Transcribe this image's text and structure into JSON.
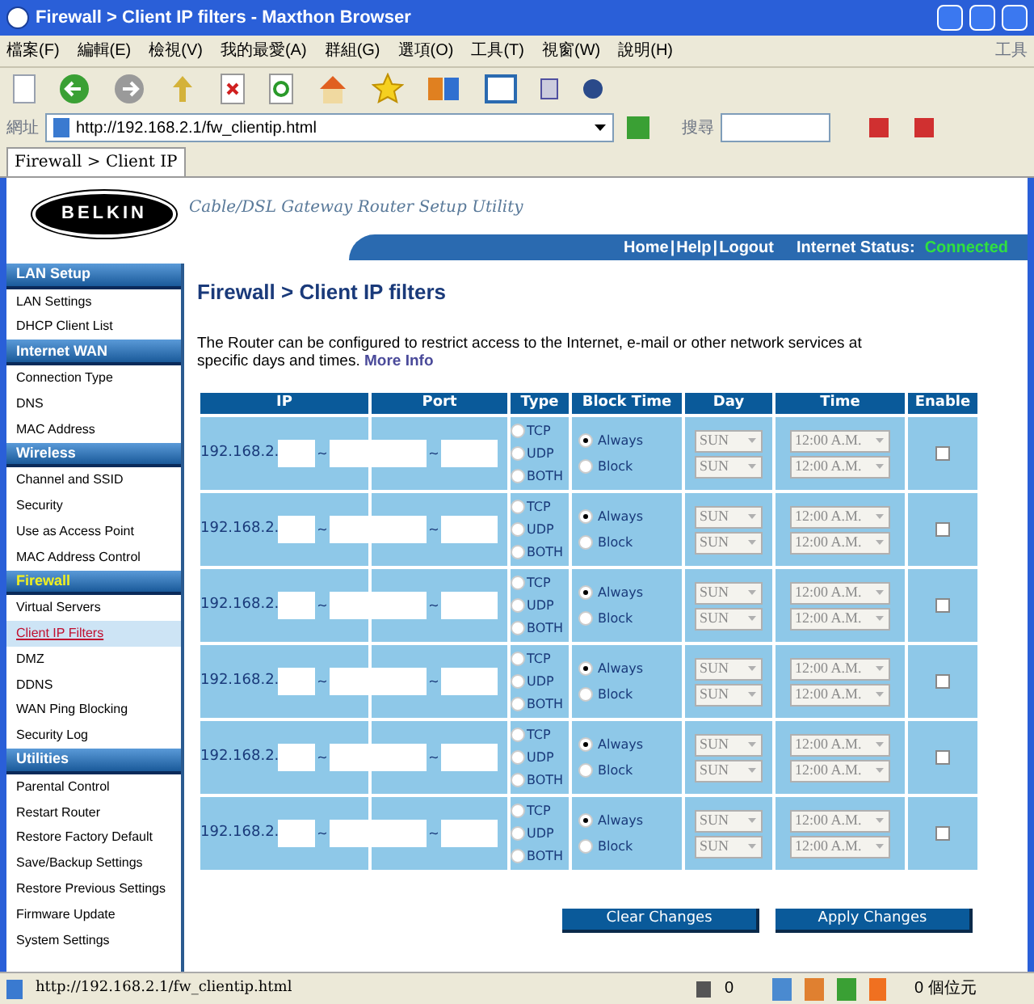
{
  "window": {
    "title": "Firewall > Client IP filters - Maxthon Browser"
  },
  "menu": [
    "檔案(F)",
    "編輯(E)",
    "檢視(V)",
    "我的最愛(A)",
    "群組(G)",
    "選項(O)",
    "工具(T)",
    "視窗(W)",
    "說明(H)"
  ],
  "menu_right": "工具",
  "address_bar": {
    "label": "網址",
    "value": "http://192.168.2.1/fw_clientip.html",
    "search_label": "搜尋"
  },
  "tabs": [
    {
      "label": "Firewall > Client IP",
      "selected": true
    }
  ],
  "header": {
    "logo": "BELKIN",
    "subtitle": "Cable/DSL Gateway Router Setup Utility",
    "links": [
      "Home",
      "Help",
      "Logout"
    ],
    "link_separator": "|",
    "status_label": "Internet Status:",
    "status_value": "Connected"
  },
  "sidebar": [
    {
      "kind": "section",
      "label": "LAN Setup",
      "selected": false
    },
    {
      "kind": "item",
      "label": "LAN Settings",
      "selected": false
    },
    {
      "kind": "item",
      "label": "DHCP Client List",
      "selected": false
    },
    {
      "kind": "section",
      "label": "Internet WAN",
      "selected": false
    },
    {
      "kind": "item",
      "label": "Connection Type",
      "selected": false
    },
    {
      "kind": "item",
      "label": "DNS",
      "selected": false
    },
    {
      "kind": "item",
      "label": "MAC Address",
      "selected": false
    },
    {
      "kind": "section",
      "label": "Wireless",
      "selected": false
    },
    {
      "kind": "item",
      "label": "Channel and SSID",
      "selected": false
    },
    {
      "kind": "item",
      "label": "Security",
      "selected": false
    },
    {
      "kind": "item",
      "label": "Use as Access Point",
      "selected": false
    },
    {
      "kind": "item",
      "label": "MAC Address Control",
      "selected": false
    },
    {
      "kind": "section",
      "label": "Firewall",
      "selected": true
    },
    {
      "kind": "item",
      "label": "Virtual Servers",
      "selected": false
    },
    {
      "kind": "item",
      "label": "Client IP Filters",
      "selected": true
    },
    {
      "kind": "item",
      "label": "DMZ",
      "selected": false
    },
    {
      "kind": "item",
      "label": "DDNS",
      "selected": false
    },
    {
      "kind": "item",
      "label": "WAN Ping Blocking",
      "selected": false
    },
    {
      "kind": "item",
      "label": "Security Log",
      "selected": false
    },
    {
      "kind": "section",
      "label": "Utilities",
      "selected": false
    },
    {
      "kind": "item",
      "label": "Parental Control",
      "selected": false
    },
    {
      "kind": "item",
      "label": "Restart Router",
      "selected": false
    },
    {
      "kind": "item",
      "label": "Restore Factory Default",
      "selected": false
    },
    {
      "kind": "item",
      "label": "Save/Backup Settings",
      "selected": false
    },
    {
      "kind": "item",
      "label": "Restore Previous Settings",
      "selected": false
    },
    {
      "kind": "item",
      "label": "Firmware Update",
      "selected": false
    },
    {
      "kind": "item",
      "label": "System Settings",
      "selected": false
    }
  ],
  "page": {
    "title": "Firewall > Client IP filters",
    "description": "The Router can be configured to restrict access to the Internet, e-mail or other network services at specific days and times.",
    "more_info": "More Info"
  },
  "table": {
    "columns": [
      "IP",
      "Port",
      "Type",
      "Block Time",
      "Day",
      "Time",
      "Enable"
    ],
    "rows": [
      {
        "ip_prefix": "192.168.2.",
        "ip_sep": "~",
        "port_sep": "~",
        "types": [
          {
            "label": "TCP",
            "selected": false
          },
          {
            "label": "UDP",
            "selected": false
          },
          {
            "label": "BOTH",
            "selected": false
          }
        ],
        "block": [
          {
            "label": "Always",
            "selected": true
          },
          {
            "label": "Block",
            "selected": false
          }
        ],
        "days": [
          "SUN",
          "SUN"
        ],
        "times": [
          "12:00 A.M.",
          "12:00 A.M."
        ],
        "enabled": false
      },
      {
        "ip_prefix": "192.168.2.",
        "ip_sep": "~",
        "port_sep": "~",
        "types": [
          {
            "label": "TCP",
            "selected": false
          },
          {
            "label": "UDP",
            "selected": false
          },
          {
            "label": "BOTH",
            "selected": false
          }
        ],
        "block": [
          {
            "label": "Always",
            "selected": true
          },
          {
            "label": "Block",
            "selected": false
          }
        ],
        "days": [
          "SUN",
          "SUN"
        ],
        "times": [
          "12:00 A.M.",
          "12:00 A.M."
        ],
        "enabled": false
      },
      {
        "ip_prefix": "192.168.2.",
        "ip_sep": "~",
        "port_sep": "~",
        "types": [
          {
            "label": "TCP",
            "selected": false
          },
          {
            "label": "UDP",
            "selected": false
          },
          {
            "label": "BOTH",
            "selected": false
          }
        ],
        "block": [
          {
            "label": "Always",
            "selected": true
          },
          {
            "label": "Block",
            "selected": false
          }
        ],
        "days": [
          "SUN",
          "SUN"
        ],
        "times": [
          "12:00 A.M.",
          "12:00 A.M."
        ],
        "enabled": false
      },
      {
        "ip_prefix": "192.168.2.",
        "ip_sep": "~",
        "port_sep": "~",
        "types": [
          {
            "label": "TCP",
            "selected": false
          },
          {
            "label": "UDP",
            "selected": false
          },
          {
            "label": "BOTH",
            "selected": false
          }
        ],
        "block": [
          {
            "label": "Always",
            "selected": true
          },
          {
            "label": "Block",
            "selected": false
          }
        ],
        "days": [
          "SUN",
          "SUN"
        ],
        "times": [
          "12:00 A.M.",
          "12:00 A.M."
        ],
        "enabled": false
      },
      {
        "ip_prefix": "192.168.2.",
        "ip_sep": "~",
        "port_sep": "~",
        "types": [
          {
            "label": "TCP",
            "selected": false
          },
          {
            "label": "UDP",
            "selected": false
          },
          {
            "label": "BOTH",
            "selected": false
          }
        ],
        "block": [
          {
            "label": "Always",
            "selected": true
          },
          {
            "label": "Block",
            "selected": false
          }
        ],
        "days": [
          "SUN",
          "SUN"
        ],
        "times": [
          "12:00 A.M.",
          "12:00 A.M."
        ],
        "enabled": false
      },
      {
        "ip_prefix": "192.168.2.",
        "ip_sep": "~",
        "port_sep": "~",
        "types": [
          {
            "label": "TCP",
            "selected": false
          },
          {
            "label": "UDP",
            "selected": false
          },
          {
            "label": "BOTH",
            "selected": false
          }
        ],
        "block": [
          {
            "label": "Always",
            "selected": true
          },
          {
            "label": "Block",
            "selected": false
          }
        ],
        "days": [
          "SUN",
          "SUN"
        ],
        "times": [
          "12:00 A.M.",
          "12:00 A.M."
        ],
        "enabled": false
      }
    ]
  },
  "buttons": [
    "Clear Changes",
    "Apply Changes"
  ],
  "status_bar": {
    "url": "http://192.168.2.1/fw_clientip.html",
    "trash_count": "0",
    "bytes": "0 個位元"
  }
}
